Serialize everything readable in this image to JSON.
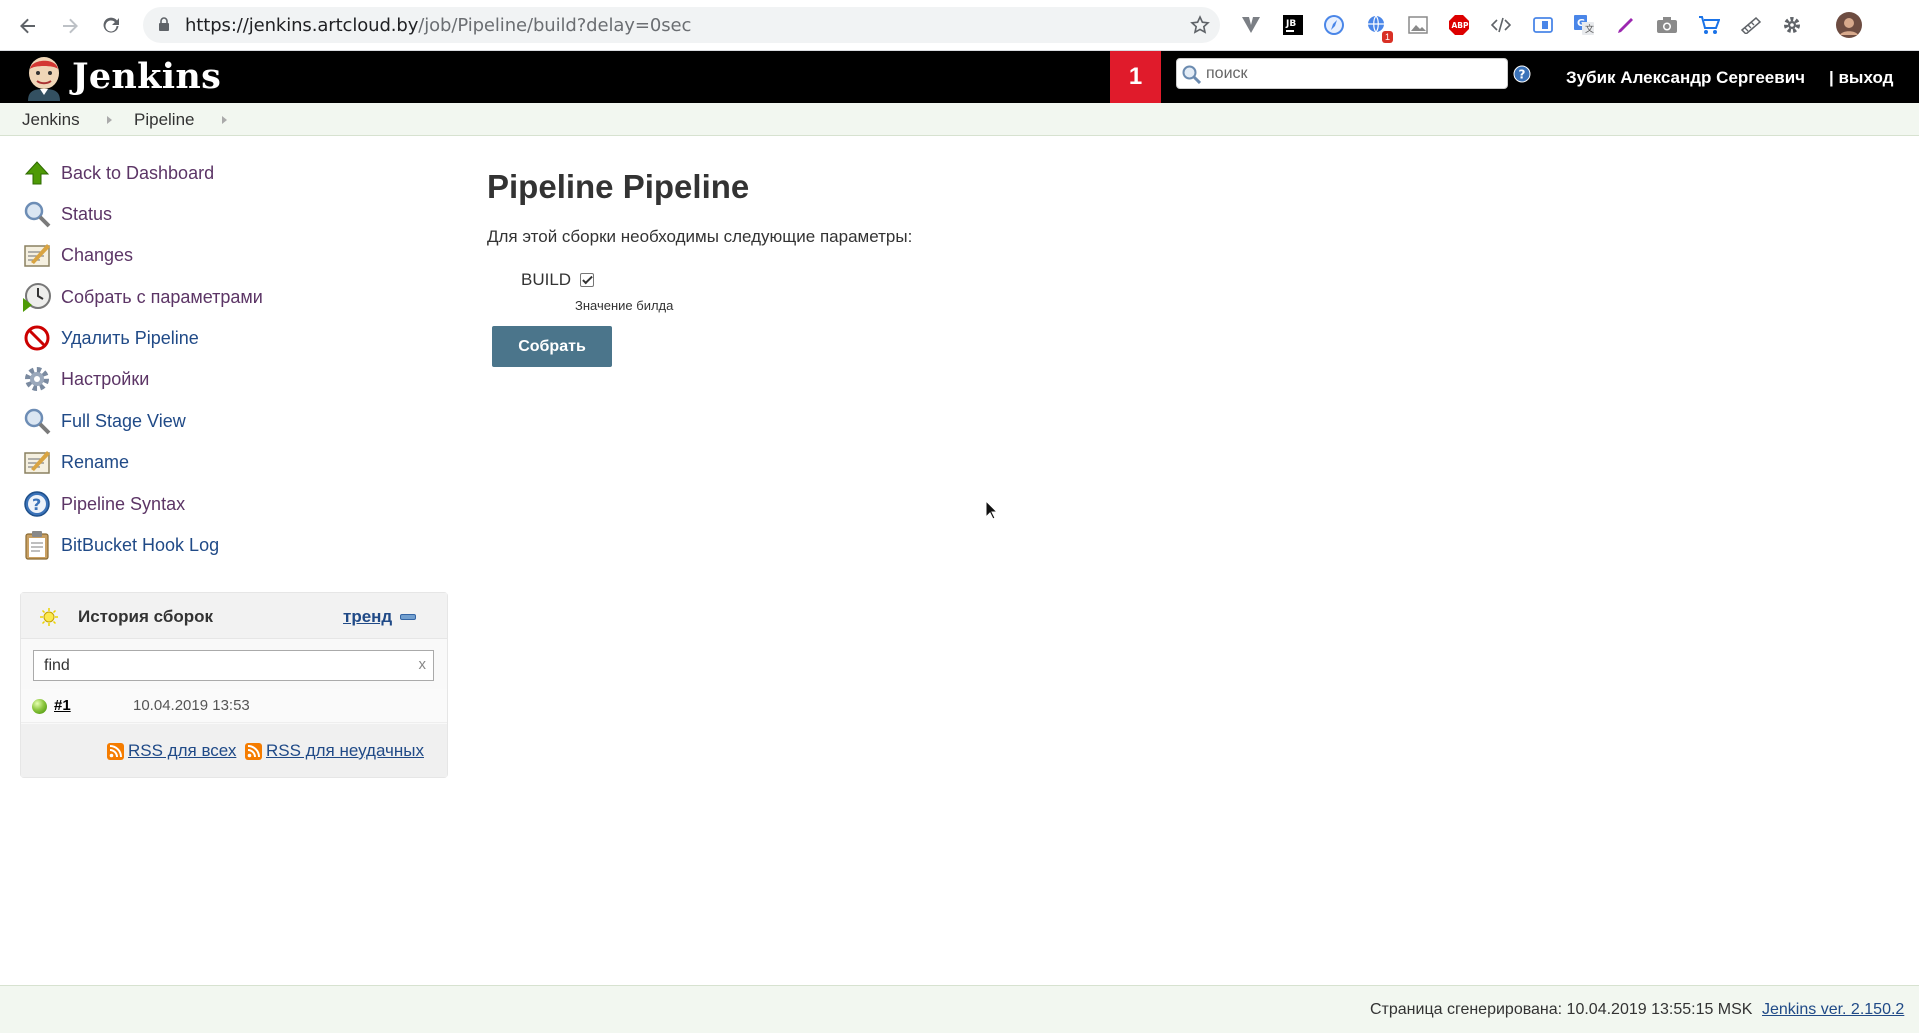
{
  "browser": {
    "url_host": "https://jenkins.artcloud.by",
    "url_path": "/job/Pipeline/build?delay=0sec",
    "extension_badge": "1",
    "extensions": [
      "vuetify-icon",
      "jetbrains-icon",
      "safari-icon",
      "translate-globe-icon",
      "image-icon",
      "adblock-icon",
      "code-icon",
      "screen-reader-icon",
      "google-translate-icon",
      "pen-icon",
      "camera-icon",
      "cart-icon",
      "whatsnew-icon",
      "settings-gear-icon",
      "profile-avatar"
    ]
  },
  "header": {
    "title": "Jenkins",
    "notifications": "1",
    "search_placeholder": "поиск",
    "user": "Зубик Александр Сергеевич",
    "logout": "| выход"
  },
  "breadcrumbs": [
    "Jenkins",
    "Pipeline"
  ],
  "sidebar": {
    "tasks": [
      {
        "label": "Back to Dashboard",
        "icon": "up-arrow-icon"
      },
      {
        "label": "Status",
        "icon": "magnifier-icon"
      },
      {
        "label": "Changes",
        "icon": "notepad-icon"
      },
      {
        "label": "Собрать с параметрами",
        "icon": "clock-icon"
      },
      {
        "label": "Удалить Pipeline",
        "icon": "no-entry-icon"
      },
      {
        "label": "Настройки",
        "icon": "gear-icon"
      },
      {
        "label": "Full Stage View",
        "icon": "magnifier-icon"
      },
      {
        "label": "Rename",
        "icon": "notepad-icon"
      },
      {
        "label": "Pipeline Syntax",
        "icon": "help-icon"
      },
      {
        "label": "BitBucket Hook Log",
        "icon": "clipboard-icon"
      }
    ],
    "history": {
      "title": "История сборок",
      "trend": "тренд",
      "find_value": "find",
      "clear": "x",
      "builds": [
        {
          "number": "#1",
          "date": "10.04.2019 13:53",
          "status": "success"
        }
      ],
      "rss_all": "RSS для всех",
      "rss_failed": "RSS для неудачных"
    }
  },
  "main": {
    "title": "Pipeline Pipeline",
    "description": "Для этой сборки необходимы следующие параметры:",
    "param_name": "BUILD",
    "param_checked": true,
    "param_description": "Значение билда",
    "submit": "Собрать"
  },
  "footer": {
    "generated": "Страница сгенерирована: 10.04.2019 13:55:15 MSK",
    "version": "Jenkins ver. 2.150.2"
  },
  "colors": {
    "header_bg": "#000000",
    "notification_bg": "#e01b2b",
    "breadcrumb_bg": "#f2f7f0",
    "link": "#204a87",
    "visited_link": "#5c3566",
    "button_bg": "#4b758b"
  }
}
